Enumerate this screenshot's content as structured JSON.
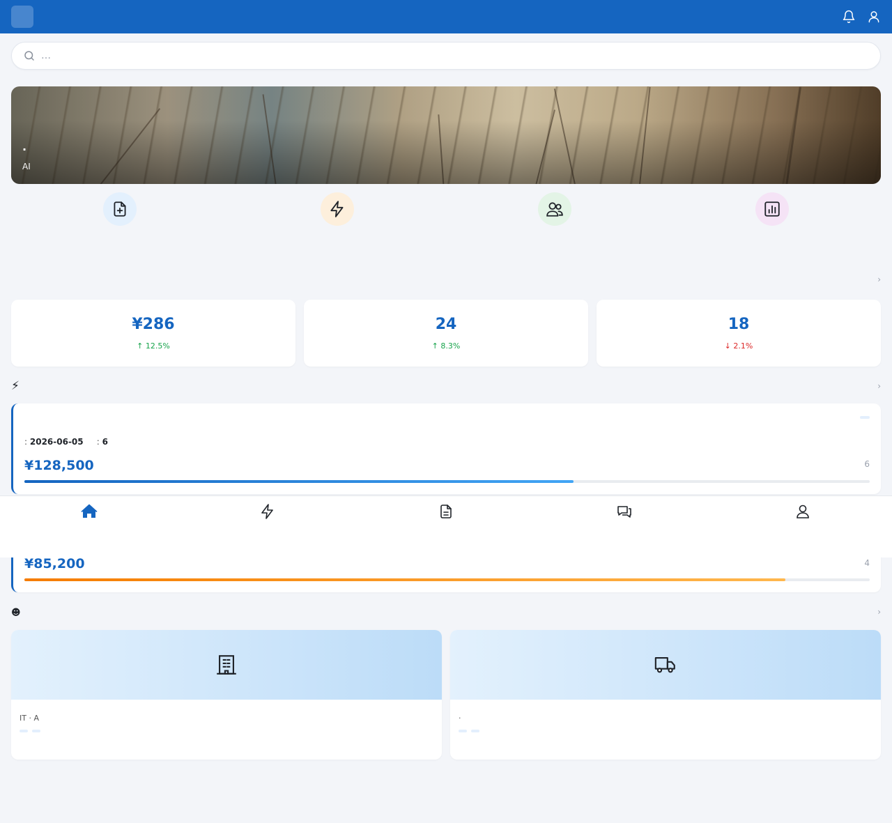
{
  "header": {
    "logo_glyph": "",
    "title": "",
    "bell_icon": "bell-icon",
    "user_icon": "user-icon"
  },
  "search": {
    "placeholder": "…"
  },
  "banner": {
    "title": " · ",
    "subtitle": "AI"
  },
  "quick_actions": [
    {
      "label": "",
      "icon": "file-plus-icon",
      "bg": "#e3f0fd"
    },
    {
      "label": "",
      "icon": "lightning-icon",
      "bg": "#fdefdc"
    },
    {
      "label": "",
      "icon": "users-icon",
      "bg": "#e3f4e6"
    },
    {
      "label": "",
      "icon": "bar-chart-icon",
      "bg": "#f5e3f6"
    }
  ],
  "stats_section": {
    "title": " ",
    "more": " ›"
  },
  "stats": [
    {
      "value": "¥286",
      "label": "",
      "change": "↑ 12.5%",
      "direction": "up"
    },
    {
      "value": "24",
      "label": "",
      "change": "↑ 8.3%",
      "direction": "up"
    },
    {
      "value": "18",
      "label": "",
      "change": "↓ 2.1%",
      "direction": "down"
    }
  ],
  "projects_section": {
    "title": "⚡ ",
    "more": " ›"
  },
  "projects": [
    {
      "title": "",
      "badge": "",
      "meta_label_1": ":",
      "meta_value_1": "2026-06-05",
      "meta_label_2": ":",
      "meta_value_2": "6",
      "amount": "¥128,500",
      "amount_note": "",
      "remaining": "6",
      "progress": 0.65,
      "color_start": "#1565c0",
      "color_end": "#42a5f5"
    },
    {
      "amount": "¥85,200",
      "amount_note": "",
      "remaining": "4",
      "progress": 0.9,
      "color_start": "#f57c00",
      "color_end": "#ffb74d"
    }
  ],
  "tabbar": [
    {
      "label": "",
      "icon": "home-icon",
      "active": true
    },
    {
      "label": "",
      "icon": "lightning-icon",
      "active": false
    },
    {
      "label": "",
      "icon": "document-icon",
      "active": false
    },
    {
      "label": "",
      "icon": "chat-icon",
      "active": false
    },
    {
      "label": "",
      "icon": "user-icon",
      "active": false
    }
  ],
  "partners_section": {
    "title": " ",
    "icon_glyph": "☻",
    "more": " ›"
  },
  "partners": [
    {
      "name": "",
      "desc": "IT · A",
      "tags": [
        "",
        ""
      ],
      "icon": "building-icon"
    },
    {
      "name": "",
      "desc": " · ",
      "tags": [
        "",
        ""
      ],
      "icon": "truck-icon"
    }
  ],
  "colors": {
    "primary": "#1565c0",
    "up": "#16a34a",
    "down": "#dc2626",
    "background": "#f3f5f9"
  }
}
